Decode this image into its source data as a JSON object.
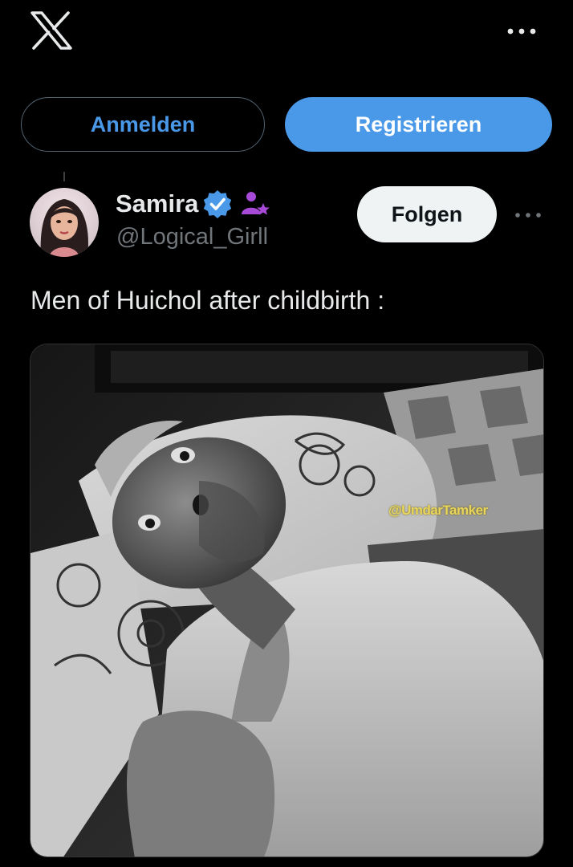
{
  "header": {
    "logo_icon": "x-logo-icon",
    "more_icon": "more-horizontal-icon"
  },
  "auth": {
    "login_label": "Anmelden",
    "register_label": "Registrieren"
  },
  "post": {
    "author": {
      "display_name": "Samira",
      "handle": "@Logical_Girll",
      "verified_icon": "verified-badge-icon",
      "affiliate_icon": "affiliate-badge-icon"
    },
    "follow_label": "Folgen",
    "more_icon": "more-horizontal-icon",
    "text": "Men of Huichol after childbirth :",
    "media": {
      "watermark": "@UmdarTamker"
    }
  },
  "colors": {
    "background": "#000000",
    "accent": "#4a99e9",
    "text_primary": "#e7e9ea",
    "text_secondary": "#71767b",
    "follow_bg": "#eff3f4",
    "affiliate": "#a64ad7"
  }
}
